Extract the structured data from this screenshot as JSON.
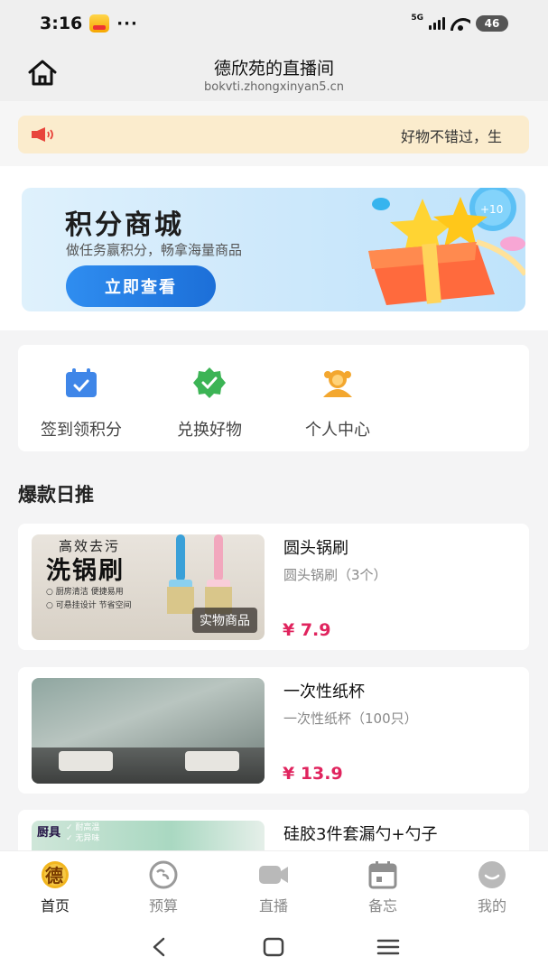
{
  "status_bar": {
    "time": "3:16",
    "dots": "···",
    "network": "5G",
    "battery": "46"
  },
  "header": {
    "title": "德欣苑的直播间",
    "url": "bokvti.zhongxinyan5.cn",
    "home_icon": "home-icon"
  },
  "notice": {
    "icon": "speaker-icon",
    "text": "好物不错过，生"
  },
  "banner": {
    "title": "积分商城",
    "subtitle": "做任务赢积分，畅拿海量商品",
    "button": "立即查看",
    "badge": "+10"
  },
  "menu": {
    "items": [
      {
        "label": "签到领积分",
        "icon": "calendar-check-icon",
        "color": "#3f86e8"
      },
      {
        "label": "兑换好物",
        "icon": "badge-check-icon",
        "color": "#3cb455"
      },
      {
        "label": "个人中心",
        "icon": "user-icon",
        "color": "#f3a72f"
      }
    ]
  },
  "section": {
    "title": "爆款日推"
  },
  "products": [
    {
      "name": "圆头锅刷",
      "desc": "圆头锅刷（3个）",
      "price": "¥ 7.9",
      "image": {
        "line1": "高效去污",
        "line2": "洗锅刷",
        "line3": "○ 厨房清洁  便捷易用",
        "line4": "○ 可悬挂设计  节省空间",
        "tag": "实物商品"
      }
    },
    {
      "name": "一次性纸杯",
      "desc": "一次性纸杯（100只）",
      "price": "¥ 13.9"
    },
    {
      "name": "硅胶3件套漏勺+勺子",
      "image": {
        "label": "厨具",
        "line1": "✓ 耐高温",
        "line2": "✓ 无异味"
      }
    }
  ],
  "tabbar": {
    "tabs": [
      {
        "label": "首页",
        "icon": "de-logo-icon",
        "active": true
      },
      {
        "label": "预算",
        "icon": "budget-icon",
        "active": false
      },
      {
        "label": "直播",
        "icon": "video-camera-icon",
        "active": false
      },
      {
        "label": "备忘",
        "icon": "calendar-icon",
        "active": false
      },
      {
        "label": "我的",
        "icon": "profile-face-icon",
        "active": false
      }
    ],
    "logo_char": "德"
  },
  "colors": {
    "accent": "#e0245e",
    "notice_bg": "#fbeccd",
    "banner_button": "#2f8df0",
    "tab_active_icon": "#f2b61f"
  }
}
